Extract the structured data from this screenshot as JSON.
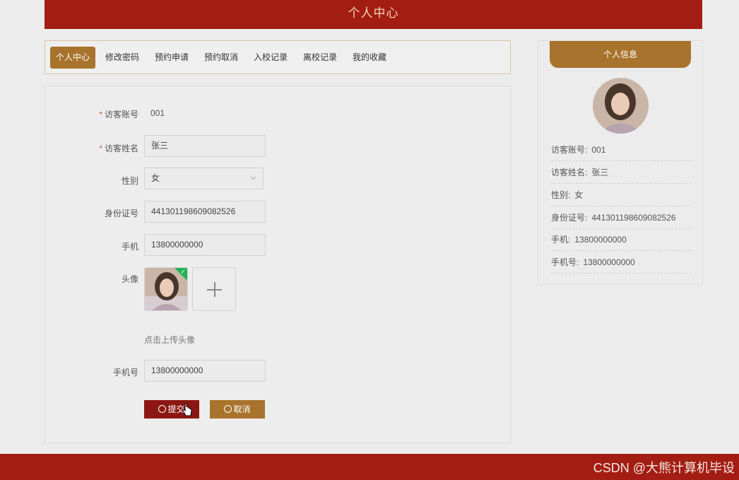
{
  "header": {
    "title": "个人中心"
  },
  "tabs": [
    {
      "label": "个人中心",
      "active": true
    },
    {
      "label": "修改密码",
      "active": false
    },
    {
      "label": "预约申请",
      "active": false
    },
    {
      "label": "预约取消",
      "active": false
    },
    {
      "label": "入校记录",
      "active": false
    },
    {
      "label": "离校记录",
      "active": false
    },
    {
      "label": "我的收藏",
      "active": false
    }
  ],
  "form": {
    "account": {
      "label": "访客账号",
      "value": "001",
      "required": true
    },
    "name": {
      "label": "访客姓名",
      "value": "张三",
      "required": true
    },
    "gender": {
      "label": "性别",
      "value": "女"
    },
    "id_number": {
      "label": "身份证号",
      "value": "441301198609082526"
    },
    "mobile": {
      "label": "手机",
      "value": "13800000000"
    },
    "avatar": {
      "label": "头像",
      "hint": "点击上传头像"
    },
    "phone": {
      "label": "手机号",
      "value": "13800000000"
    },
    "submit_label": "提交",
    "cancel_label": "取消"
  },
  "info": {
    "title": "个人信息",
    "rows": [
      {
        "key": "访客账号:",
        "value": "001"
      },
      {
        "key": "访客姓名:",
        "value": "张三"
      },
      {
        "key": "性别:",
        "value": "女"
      },
      {
        "key": "身份证号:",
        "value": "441301198609082526"
      },
      {
        "key": "手机:",
        "value": "13800000000"
      },
      {
        "key": "手机号:",
        "value": "13800000000"
      }
    ]
  },
  "footer": {
    "watermark": "CSDN @大熊计算机毕设"
  },
  "colors": {
    "header": "#a31d12",
    "accent": "#a8732c",
    "submit": "#8c1712",
    "success": "#21b35a"
  }
}
